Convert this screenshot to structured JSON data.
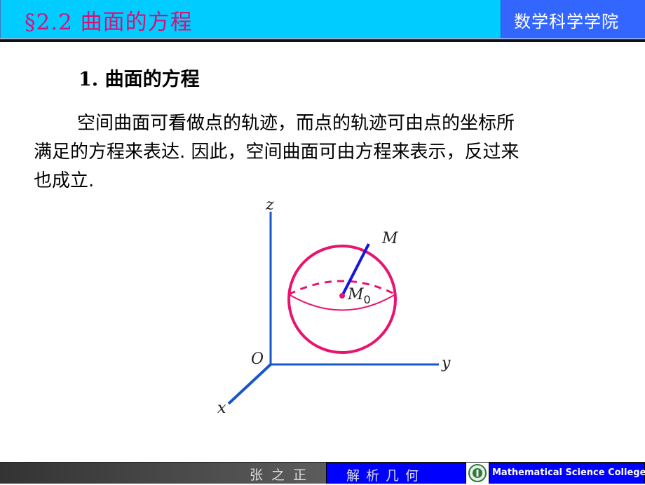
{
  "header": {
    "title": "§2.2 曲面的方程",
    "institution": "数学科学学院"
  },
  "content": {
    "section_heading": "1. 曲面的方程",
    "paragraph_lines": [
      "空间曲面可看做点的轨迹，而点的轨迹可由点的坐标所",
      "满足的方程来表达. 因此，空间曲面可由方程来表示，反过来",
      "也成立."
    ]
  },
  "figure": {
    "description": "sphere centered at M0 with radius segment to point M in 3D coordinate system",
    "labels": {
      "z_axis": "z",
      "y_axis": "y",
      "x_axis": "x",
      "origin": "O",
      "point_surface": "M",
      "center": "M",
      "center_subscript": "0"
    },
    "colors": {
      "axes": "#1a56c8",
      "sphere": "#e8146e",
      "radius": "#1515e0"
    }
  },
  "footer": {
    "author": "张之正",
    "course": "解析几何",
    "college": "Mathematical Science College",
    "logo_icon": "university-emblem-icon"
  },
  "colors": {
    "header_bg": "#00ccff",
    "header_title": "#d6127a",
    "header_right_bg": "#3366ff",
    "footer_blue": "#0000ff"
  }
}
